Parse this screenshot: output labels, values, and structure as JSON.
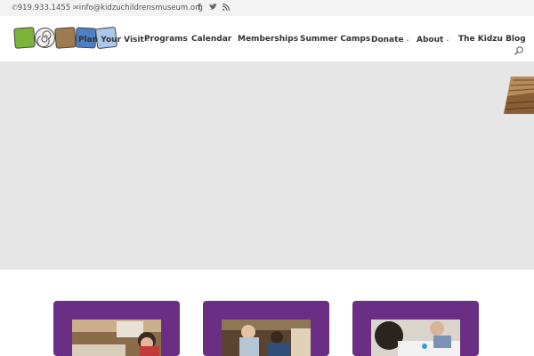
{
  "topbar": {
    "phone": "919.933.1455",
    "email": "info@kidzuchildrensmuseum.org",
    "icons": [
      "phone-icon",
      "mail-icon",
      "facebook-icon",
      "twitter-icon",
      "rss-icon"
    ]
  },
  "nav": {
    "items": [
      {
        "label": "Plan Your Visit",
        "dropdown": true
      },
      {
        "label": "Programs",
        "dropdown": false
      },
      {
        "label": "Calendar",
        "dropdown": false
      },
      {
        "label": "Memberships",
        "dropdown": false
      },
      {
        "label": "Summer Camps",
        "dropdown": false
      },
      {
        "label": "Donate",
        "dropdown": true
      },
      {
        "label": "About",
        "dropdown": true
      },
      {
        "label": "The Kidzu Blog",
        "dropdown": false
      }
    ]
  },
  "colors": {
    "topbar_bg": "#f3f3f3",
    "hero_bg": "#e6e6e6",
    "card_purple": "#6a2f85",
    "nav_text": "#333333"
  }
}
